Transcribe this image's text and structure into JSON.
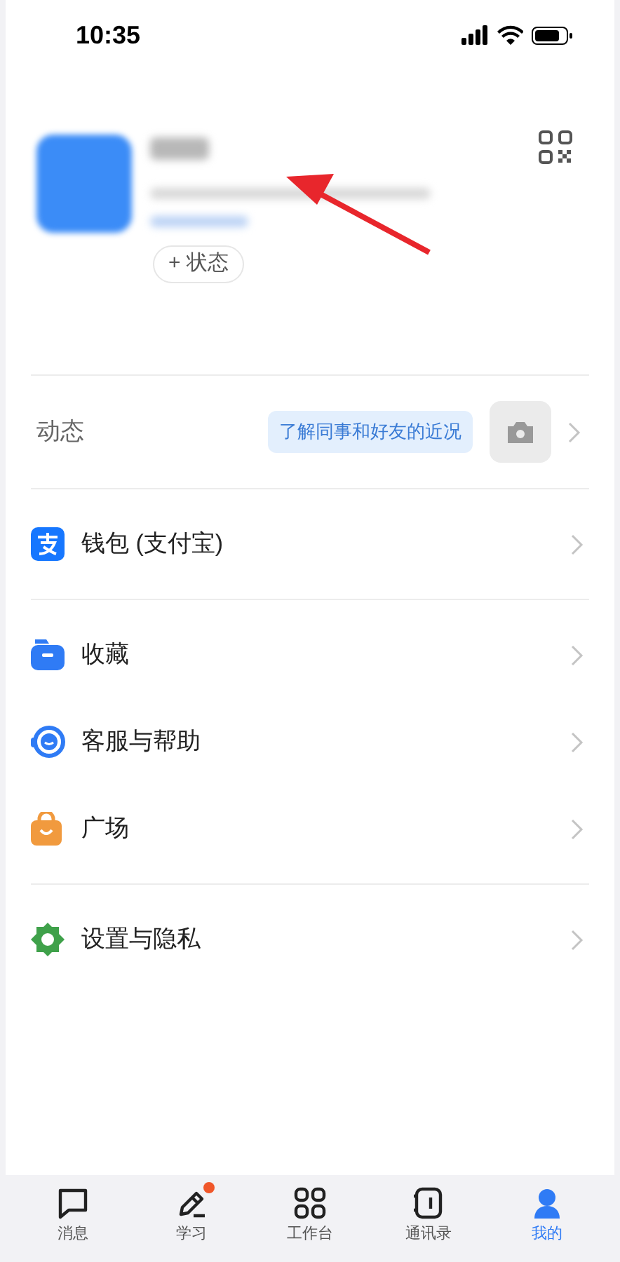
{
  "status_bar": {
    "time": "10:35"
  },
  "profile": {
    "status_button": "+ 状态"
  },
  "moments": {
    "label": "动态",
    "hint": "了解同事和好友的近况"
  },
  "menu_groups": [
    [
      {
        "kind": "wallet",
        "label": "钱包 (支付宝)"
      }
    ],
    [
      {
        "kind": "favorites",
        "label": "收藏"
      },
      {
        "kind": "support",
        "label": "客服与帮助"
      },
      {
        "kind": "plaza",
        "label": "广场"
      }
    ],
    [
      {
        "kind": "settings",
        "label": "设置与隐私"
      }
    ]
  ],
  "tabs": [
    {
      "kind": "messages",
      "label": "消息",
      "selected": false,
      "badge": false
    },
    {
      "kind": "learn",
      "label": "学习",
      "selected": false,
      "badge": true
    },
    {
      "kind": "workbench",
      "label": "工作台",
      "selected": false,
      "badge": false
    },
    {
      "kind": "contacts",
      "label": "通讯录",
      "selected": false,
      "badge": false
    },
    {
      "kind": "me",
      "label": "我的",
      "selected": true,
      "badge": false
    }
  ]
}
